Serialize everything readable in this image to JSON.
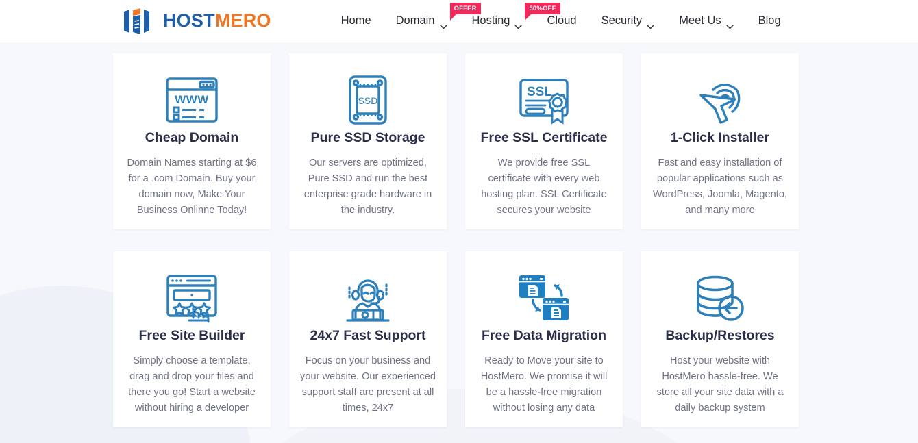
{
  "header": {
    "logo": {
      "icon": "hostmero-logo-icon",
      "text_primary": "HOST",
      "text_secondary": "MERO",
      "color_primary": "#1f5fa9",
      "color_secondary": "#ef7622"
    },
    "nav": [
      {
        "label": "Home",
        "has_dropdown": false,
        "badge": null
      },
      {
        "label": "Domain",
        "has_dropdown": true,
        "badge": "OFFER"
      },
      {
        "label": "Hosting",
        "has_dropdown": true,
        "badge": "50%OFF"
      },
      {
        "label": "Cloud",
        "has_dropdown": false,
        "badge": null
      },
      {
        "label": "Security",
        "has_dropdown": true,
        "badge": null
      },
      {
        "label": "Meet Us",
        "has_dropdown": true,
        "badge": null
      },
      {
        "label": "Blog",
        "has_dropdown": false,
        "badge": null
      }
    ],
    "badge_color": "#f2295b"
  },
  "features": [
    {
      "icon": "browser-www-icon",
      "title": "Cheap Domain",
      "description": "Domain Names starting at $6 for a .com Domain. Buy your domain now, Make Your Business Onlinne Today!"
    },
    {
      "icon": "ssd-drive-icon",
      "title": "Pure SSD Storage",
      "description": "Our servers are optimized, Pure SSD and run the best enterprise grade hardware in the industry."
    },
    {
      "icon": "ssl-certificate-icon",
      "title": "Free SSL Certificate",
      "description": "We provide free SSL certificate with every web hosting plan. SSL Certificate secures your website"
    },
    {
      "icon": "click-cursor-icon",
      "title": "1-Click Installer",
      "description": "Fast and easy installation of popular applications such as WordPress, Joomla, Magento, and many more"
    },
    {
      "icon": "site-builder-stars-icon",
      "title": "Free Site Builder",
      "description": "Simply choose a template, drag and drop your files and there you go! Start a website without hiring a developer"
    },
    {
      "icon": "support-agent-icon",
      "title": "24x7 Fast Support",
      "description": "Focus on your business and your website. Our experienced support staff are present at all times, 24x7"
    },
    {
      "icon": "data-migration-icon",
      "title": "Free Data Migration",
      "description": "Ready to Move your site to HostMero. We promise it will be a hassle-free migration without losing any data"
    },
    {
      "icon": "database-backup-icon",
      "title": "Backup/Restores",
      "description": "Host your website with HostMero hassle-free. We store all your site data with a daily backup system"
    }
  ],
  "theme": {
    "icon_stroke": "#2e80ba",
    "icon_fill": "#1f7fc0",
    "page_background": "#f7f8fb",
    "card_background": "#ffffff",
    "title_color": "#2b2f4a",
    "text_color": "#6f7384"
  }
}
